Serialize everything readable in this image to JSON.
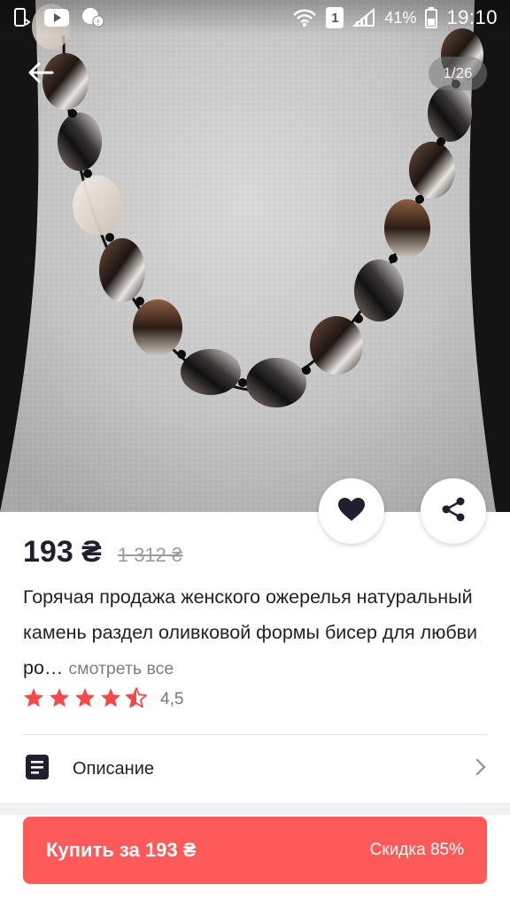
{
  "status_bar": {
    "battery_percent": "41%",
    "time": "19:10",
    "sim_slot": "1"
  },
  "gallery": {
    "counter": "1/26"
  },
  "product": {
    "price": "193 ₴",
    "old_price": "1 312 ₴",
    "title": "Горячая продажа женского ожерелья натуральный камень раздел оливковой формы бисер для любви ро…",
    "see_all": "смотреть все",
    "rating": 4.5,
    "rating_text": "4,5"
  },
  "description_row": {
    "label": "Описание"
  },
  "buy_bar": {
    "label": "Купить за 193 ₴",
    "discount": "Скидка 85%"
  },
  "colors": {
    "accent": "#ff5a5a",
    "star": "#f04a4a",
    "text_dark": "#1f1f2e"
  },
  "icons": [
    "back-arrow-icon",
    "heart-icon",
    "share-icon",
    "document-icon",
    "chevron-right-icon",
    "star-icon",
    "wifi-icon",
    "signal-icon",
    "battery-icon",
    "youtube-icon",
    "phone-sync-icon",
    "notification-icon"
  ]
}
